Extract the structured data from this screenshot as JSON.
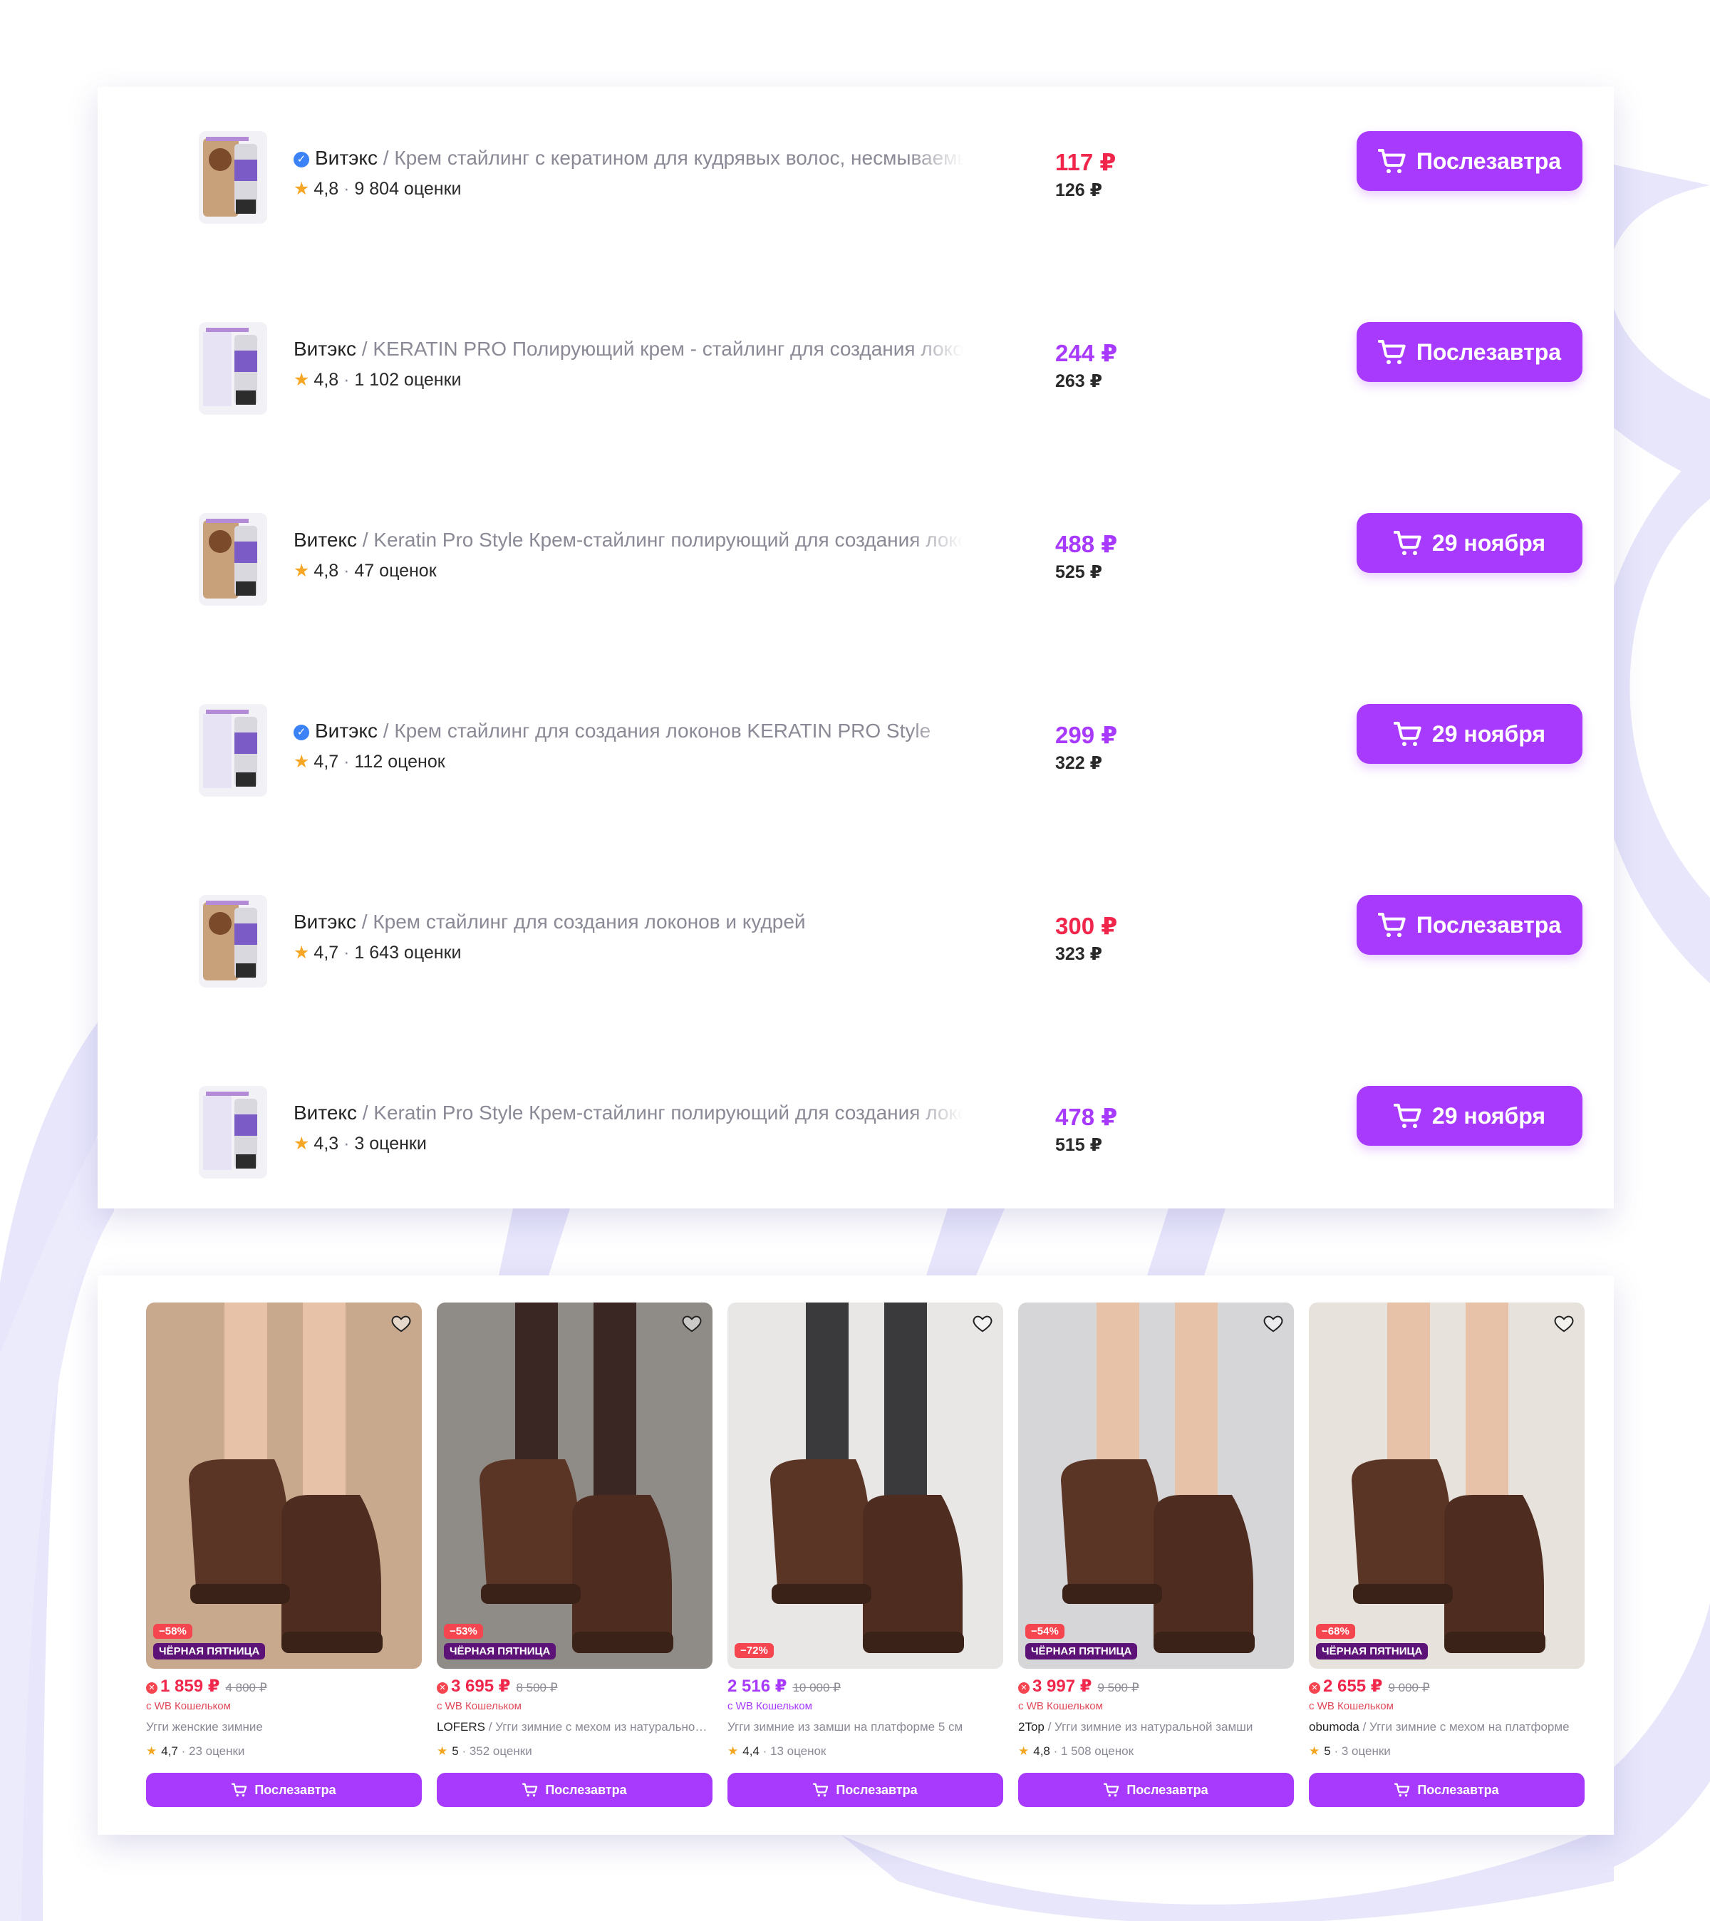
{
  "accent_color": "#a73afd",
  "sale_color": "#f5454f",
  "list_items": [
    {
      "verified": true,
      "brand": "Витэкс",
      "title": " / Крем стайлинг с кератином для кудрявых волос, несмываемый",
      "rating": "4,8",
      "reviews": "9 804 оценки",
      "price": "117 ₽",
      "price_color": "#f0264b",
      "old_price": "126 ₽",
      "button": "Послезавтра",
      "thumb_icon": "hair-cream-product-icon"
    },
    {
      "verified": false,
      "brand": "Витэкс",
      "title": " / KERATIN PRO Полирующий крем - стайлинг для создания локонов",
      "rating": "4,8",
      "reviews": "1 102 оценки",
      "price": "244 ₽",
      "price_color": "#a73afd",
      "old_price": "263 ₽",
      "button": "Послезавтра",
      "thumb_icon": "hair-cream-product-icon"
    },
    {
      "verified": false,
      "brand": "Витекс",
      "title": " / Keratin Pro Style Крем-стайлинг полирующий для создания локонов",
      "rating": "4,8",
      "reviews": "47 оценок",
      "price": "488 ₽",
      "price_color": "#a73afd",
      "old_price": "525 ₽",
      "button": "29 ноября",
      "thumb_icon": "hair-cream-product-icon"
    },
    {
      "verified": true,
      "brand": "Витэкс",
      "title": " / Крем стайлинг для создания локонов KERATIN PRO Style",
      "rating": "4,7",
      "reviews": "112 оценок",
      "price": "299 ₽",
      "price_color": "#a73afd",
      "old_price": "322 ₽",
      "button": "29 ноября",
      "thumb_icon": "hair-cream-product-icon"
    },
    {
      "verified": false,
      "brand": "Витэкс",
      "title": " / Крем стайлинг для создания локонов и кудрей",
      "rating": "4,7",
      "reviews": "1 643 оценки",
      "price": "300 ₽",
      "price_color": "#f0264b",
      "old_price": "323 ₽",
      "button": "Послезавтра",
      "thumb_icon": "hair-cream-product-icon"
    },
    {
      "verified": false,
      "brand": "Витекс",
      "title": " / Keratin Pro Style Крем-стайлинг полирующий для создания локонов",
      "rating": "4,3",
      "reviews": "3 оценки",
      "price": "478 ₽",
      "price_color": "#a73afd",
      "old_price": "515 ₽",
      "button": "29 ноября",
      "thumb_icon": "hair-cream-product-icon"
    }
  ],
  "cards": [
    {
      "discount": "−58%",
      "black_friday": "ЧЁРНАЯ ПЯТНИЦА",
      "wb_icon": true,
      "price": "1 859 ₽",
      "price_color": "#f0264b",
      "old_price": "4 800 ₽",
      "wallet": "с WB Кошельком",
      "brand": "",
      "title": "Угги женские зимние",
      "rating": "4,7",
      "reviews": "23 оценки",
      "button": "Послезавтра",
      "image_icon": "brown-ugg-boots-photo"
    },
    {
      "discount": "−53%",
      "black_friday": "ЧЁРНАЯ ПЯТНИЦА",
      "wb_icon": true,
      "price": "3 695 ₽",
      "price_color": "#f0264b",
      "old_price": "8 500 ₽",
      "wallet": "с WB Кошельком",
      "brand": "LOFERS",
      "title": " / Угги зимние с мехом из натуральной замши",
      "rating": "5",
      "reviews": "352 оценки",
      "button": "Послезавтра",
      "image_icon": "brown-ugg-boots-photo"
    },
    {
      "discount": "−72%",
      "black_friday": "",
      "wb_icon": false,
      "price": "2 516 ₽",
      "price_color": "#a73afd",
      "old_price": "10 000 ₽",
      "wallet": "с WB Кошельком",
      "brand": "",
      "title": "Угги зимние из замши на платформе 5 см",
      "rating": "4,4",
      "reviews": "13 оценок",
      "button": "Послезавтра",
      "image_icon": "brown-ugg-boots-photo"
    },
    {
      "discount": "−54%",
      "black_friday": "ЧЁРНАЯ ПЯТНИЦА",
      "wb_icon": true,
      "price": "3 997 ₽",
      "price_color": "#f0264b",
      "old_price": "9 500 ₽",
      "wallet": "с WB Кошельком",
      "brand": "2Top",
      "title": " / Угги зимние из натуральной замши",
      "rating": "4,8",
      "reviews": "1 508 оценок",
      "button": "Послезавтра",
      "image_icon": "brown-ugg-boots-photo"
    },
    {
      "discount": "−68%",
      "black_friday": "ЧЁРНАЯ ПЯТНИЦА",
      "wb_icon": true,
      "price": "2 655 ₽",
      "price_color": "#f0264b",
      "old_price": "9 000 ₽",
      "wallet": "с WB Кошельком",
      "brand": "obumoda",
      "title": " / Угги зимние с мехом на платформе",
      "rating": "5",
      "reviews": "3 оценки",
      "button": "Послезавтра",
      "image_icon": "brown-ugg-boots-photo"
    }
  ]
}
